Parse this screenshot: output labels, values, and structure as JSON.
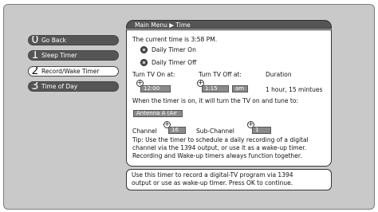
{
  "breadcrumb": "Main Menu ▶ Time",
  "menu": [
    {
      "num": "0",
      "label": "Go Back"
    },
    {
      "num": "1",
      "label": "Sleep Timer"
    },
    {
      "num": "2",
      "label": "Record/Wake Timer"
    },
    {
      "num": "3",
      "label": "Time of Day"
    }
  ],
  "panel": {
    "current_time": "The current time is 3:58 PM.",
    "radio_on": "Daily Timer On",
    "radio_off": "Daily Timer Off",
    "label_on_at": "Turn TV On at:",
    "label_off_at": "Turn TV Off at:",
    "label_duration": "Duration",
    "on_time": "12:00",
    "off_time": "1:15",
    "ampm": "am",
    "duration_value": "1 hour, 15 mintues",
    "tune_text": "When the timer is on, it will turn the TV on and tune to:",
    "antenna": "Antenna A (Air",
    "label_channel": "Channel",
    "channel_value": "16",
    "label_subchannel": "Sub-Channel",
    "subchannel_value": "1",
    "tip_line1": "Tip: Use the timer to schedule a daily recording  of a digital",
    "tip_line2": "channel via the 1394 output, or use it as a wake-up timer.",
    "tip_line3": "Recording and Wake-up timers always function together."
  },
  "help": {
    "line1": "Use this timer to record a digital-TV program via 1394",
    "line2": "output or use as wake-up timer. Press OK to continue."
  }
}
